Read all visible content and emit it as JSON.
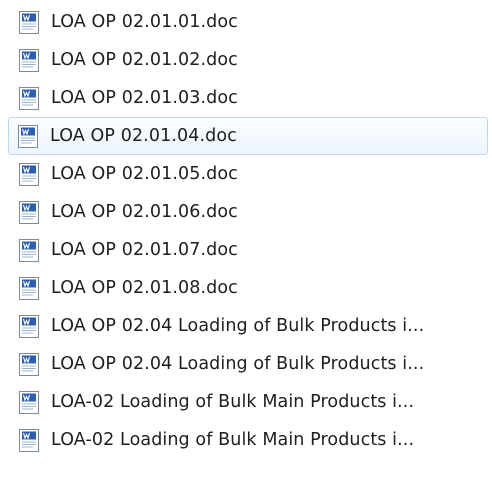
{
  "file_list": {
    "icon": "word-document-icon",
    "selected_index": 3,
    "items": [
      {
        "name": "LOA OP 02.01.01.doc"
      },
      {
        "name": "LOA OP 02.01.02.doc"
      },
      {
        "name": "LOA OP 02.01.03.doc"
      },
      {
        "name": "LOA OP 02.01.04.doc"
      },
      {
        "name": "LOA OP 02.01.05.doc"
      },
      {
        "name": "LOA OP 02.01.06.doc"
      },
      {
        "name": "LOA OP 02.01.07.doc"
      },
      {
        "name": "LOA OP 02.01.08.doc"
      },
      {
        "name": "LOA OP 02.04 Loading of Bulk Products i..."
      },
      {
        "name": "LOA OP 02.04 Loading of Bulk Products i..."
      },
      {
        "name": "LOA-02 Loading of Bulk Main Products i..."
      },
      {
        "name": "LOA-02 Loading of Bulk Main Products i..."
      }
    ]
  },
  "colors": {
    "selection_border": "#b9d7f3",
    "icon_blue": "#2b5fb5",
    "text": "#1e1e1e"
  }
}
